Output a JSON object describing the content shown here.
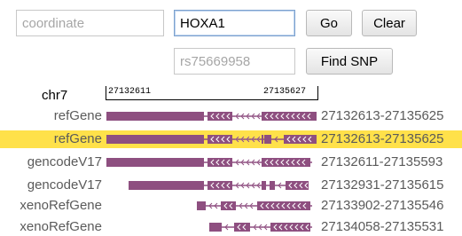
{
  "form": {
    "coordinate_placeholder": "coordinate",
    "gene_value": "HOXA1",
    "go_label": "Go",
    "clear_label": "Clear",
    "snp_placeholder": "rs75669958",
    "find_snp_label": "Find SNP"
  },
  "browser": {
    "chrom": "chr7",
    "ruler_start": "27132611",
    "ruler_end": "27135627",
    "track_color": "#8e4f80",
    "highlight_color": "#ffe14a",
    "tracks": [
      {
        "name": "refGene",
        "range": "27132613-27135625",
        "highlighted": false
      },
      {
        "name": "refGene",
        "range": "27132613-27135625",
        "highlighted": true
      },
      {
        "name": "gencodeV17",
        "range": "27132611-27135593",
        "highlighted": false
      },
      {
        "name": "gencodeV17",
        "range": "27132931-27135615",
        "highlighted": false
      },
      {
        "name": "xenoRefGene",
        "range": "27133902-27135546",
        "highlighted": false
      },
      {
        "name": "xenoRefGene",
        "range": "27134058-27135531",
        "highlighted": false
      }
    ]
  }
}
